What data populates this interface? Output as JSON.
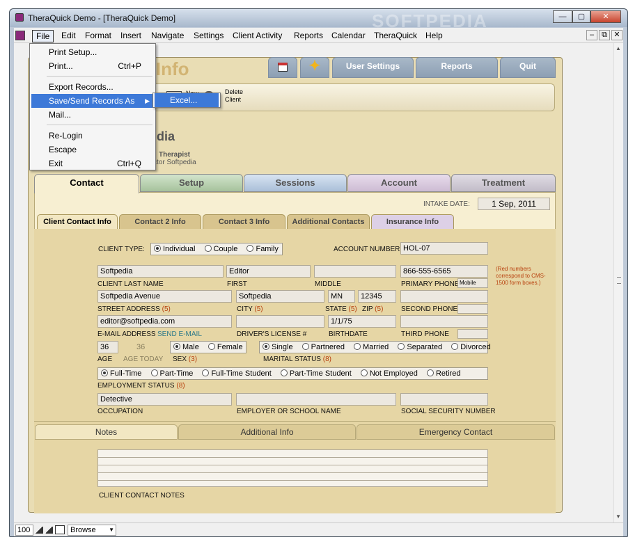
{
  "window": {
    "title": "TheraQuick Demo - [TheraQuick Demo]",
    "minimize": "—",
    "restore": "▢",
    "close": "✕"
  },
  "menubar": {
    "items": [
      "File",
      "Edit",
      "Format",
      "Insert",
      "Navigate",
      "Settings",
      "Client Activity",
      "Reports",
      "Calendar",
      "TheraQuick",
      "Help"
    ],
    "child_min": "–",
    "child_restore": "⧉",
    "child_close": "✕"
  },
  "file_menu": {
    "items": [
      {
        "label": "Print Setup...",
        "shortcut": ""
      },
      {
        "label": "Print...",
        "shortcut": "Ctrl+P"
      },
      {
        "label": "Export Records...",
        "shortcut": ""
      },
      {
        "label": "Save/Send Records As",
        "shortcut": ""
      },
      {
        "label": "Mail...",
        "shortcut": ""
      },
      {
        "label": "Re-Login",
        "shortcut": ""
      },
      {
        "label": "Escape",
        "shortcut": ""
      },
      {
        "label": "Exit",
        "shortcut": "Ctrl+Q"
      }
    ],
    "submenu_arrow": "▶",
    "submenu": {
      "label": "Excel..."
    }
  },
  "header": {
    "title": "t Info",
    "tabs": [
      "User Settings",
      "Reports",
      "Quit"
    ],
    "calendar_icon": "calendar-icon",
    "star_icon": "star-icon"
  },
  "toolbar": {
    "new_label": "New",
    "delete_label": "Delete Client"
  },
  "client": {
    "name": "dia",
    "therapist_label": "Therapist",
    "therapist": "ctor Softpedia"
  },
  "main_tabs": [
    "Contact",
    "Setup",
    "Sessions",
    "Account",
    "Treatment"
  ],
  "intake": {
    "label": "INTAKE DATE:",
    "value": "1 Sep, 2011"
  },
  "sub_tabs": [
    "Client Contact Info",
    "Contact 2 Info",
    "Contact 3 Info",
    "Additional Contacts",
    "Insurance Info"
  ],
  "form": {
    "client_type_label": "CLIENT TYPE:",
    "client_type_options": [
      "Individual",
      "Couple",
      "Family"
    ],
    "account_number_label": "ACCOUNT NUMBER:",
    "account_number": "HOL-07",
    "last_name": "Softpedia",
    "last_name_label": "CLIENT LAST NAME",
    "first": "Editor",
    "first_label": "FIRST",
    "middle": "",
    "middle_label": "MIDDLE",
    "primary_phone": "866-555-6565",
    "primary_phone_label": "PRIMARY PHONE",
    "primary_phone_type": "Mobile",
    "note": "(Red numbers correspond to CMS-1500 form boxes.)",
    "street": "Softpedia Avenue",
    "street_label": "STREET ADDRESS",
    "street_num": "(5)",
    "city": "Softpedia",
    "city_label": "CITY",
    "city_num": "(5)",
    "state": "MN",
    "state_label": "STATE",
    "state_num": "(5)",
    "zip": "12345",
    "zip_label": "ZIP",
    "zip_num": "(5)",
    "second_phone": "",
    "second_phone_label": "SECOND PHONE",
    "email": "editor@softpedia.com",
    "email_label": "E-MAIL ADDRESS",
    "send_email": "SEND E-MAIL",
    "drivers_license": "",
    "drivers_license_label": "DRIVER'S LICENSE #",
    "birthdate": "1/1/75",
    "birthdate_label": "BIRTHDATE",
    "third_phone": "",
    "third_phone_label": "THIRD PHONE",
    "age": "36",
    "age_label": "AGE",
    "age_today": "36",
    "age_today_label": "AGE TODAY",
    "sex_options": [
      "Male",
      "Female"
    ],
    "sex_label": "SEX",
    "sex_num": "(3)",
    "marital_options": [
      "Single",
      "Partnered",
      "Married",
      "Separated",
      "Divorced"
    ],
    "marital_label": "MARITAL STATUS",
    "marital_num": "(8)",
    "employment_options": [
      "Full-Time",
      "Part-Time",
      "Full-Time Student",
      "Part-Time Student",
      "Not Employed",
      "Retired"
    ],
    "employment_label": "EMPLOYMENT STATUS",
    "employment_num": "(8)",
    "occupation": "Detective",
    "occupation_label": "OCCUPATION",
    "employer": "",
    "employer_label": "EMPLOYER OR SCHOOL NAME",
    "ssn": "",
    "ssn_label": "SOCIAL SECURITY NUMBER"
  },
  "bottom_tabs": [
    "Notes",
    "Additional Info",
    "Emergency Contact"
  ],
  "notes_label": "CLIENT CONTACT NOTES",
  "status": {
    "zoom": "100",
    "mode": "Browse"
  },
  "watermark": "SOFTPEDIA"
}
